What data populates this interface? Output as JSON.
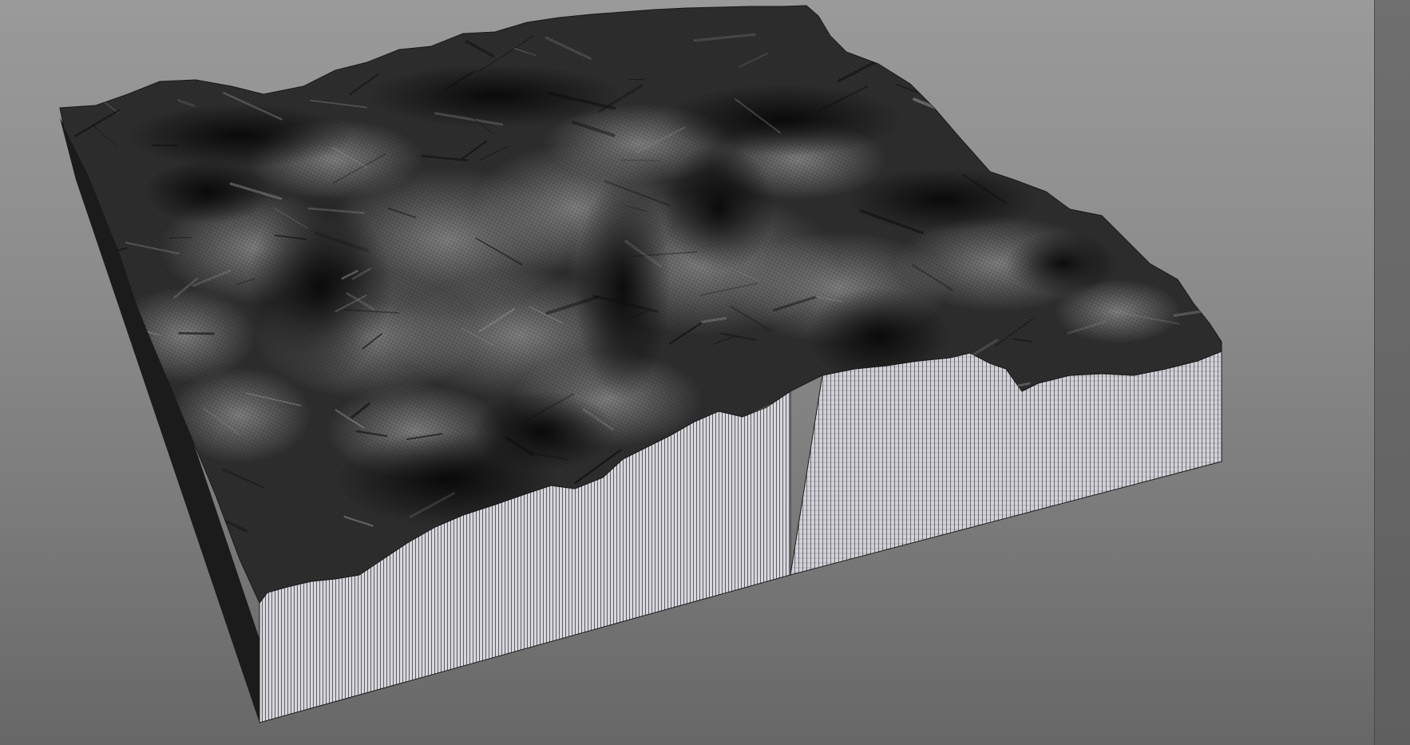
{
  "viewport": {
    "background_top": "#9a9a9a",
    "background_bottom": "#676767"
  },
  "terrain": {
    "surface_color": "#303030",
    "side_wall_color": "#d4d4dc",
    "left_wall_color": "#1b1b1b",
    "wire_color": "#1a1a1a",
    "display_mode": "wireframe-shaded"
  }
}
